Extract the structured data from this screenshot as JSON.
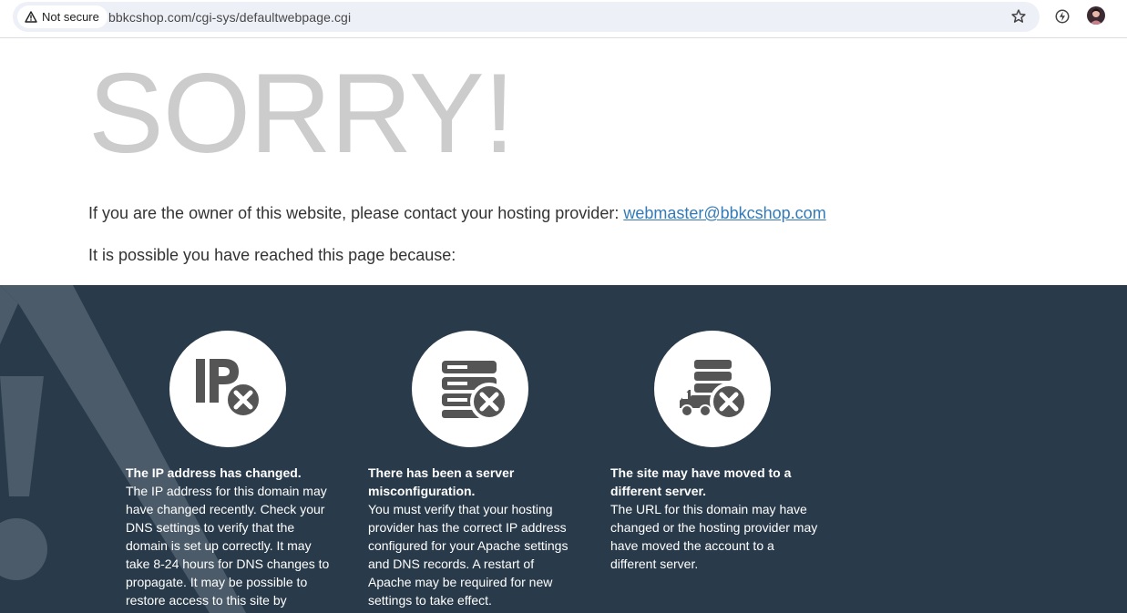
{
  "browser": {
    "security_label": "Not secure",
    "url": "bbkcshop.com/cgi-sys/defaultwebpage.cgi"
  },
  "page": {
    "heading": "SORRY!",
    "contact_text": "If you are the owner of this website, please contact your hosting provider: ",
    "contact_email": "webmaster@bbkcshop.com",
    "reason_intro": "It is possible you have reached this page because:"
  },
  "reasons": [
    {
      "icon": "ip-address-error-icon",
      "title": "The IP address has changed.",
      "body": "The IP address for this domain may have changed recently. Check your DNS settings to verify that the domain is set up correctly. It may take 8-24 hours for DNS changes to propagate. It may be possible to restore access to this site by following these instructions for"
    },
    {
      "icon": "server-error-icon",
      "title": "There has been a server misconfiguration.",
      "body": "You must verify that your hosting provider has the correct IP address configured for your Apache settings and DNS records. A restart of Apache may be required for new settings to take effect."
    },
    {
      "icon": "server-moved-icon",
      "title": "The site may have moved to a different server.",
      "body": "The URL for this domain may have changed or the hosting provider may have moved the account to a different server."
    }
  ],
  "colors": {
    "panel_bg": "#293a4a",
    "heading": "#cccccc",
    "link": "#337ab7",
    "icon": "#555555"
  }
}
